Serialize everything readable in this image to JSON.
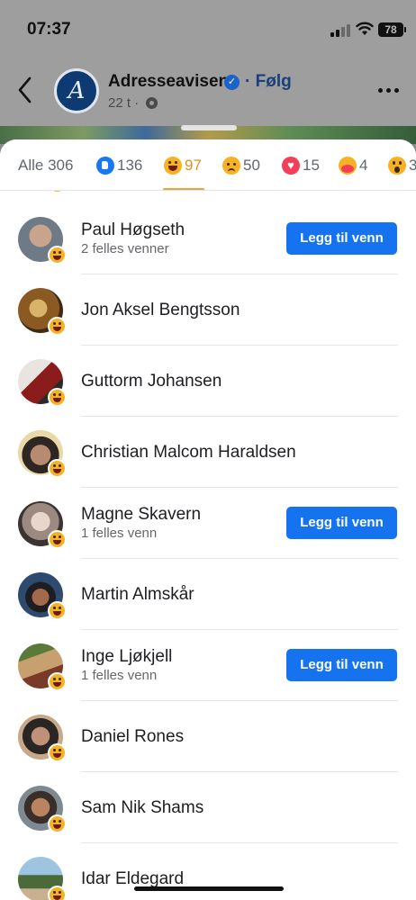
{
  "status_bar": {
    "time": "07:37",
    "battery": "78",
    "icons": [
      "signal-icon",
      "wifi-icon",
      "battery-icon"
    ]
  },
  "header": {
    "back_icon": "chevron-left-icon",
    "page_name": "Adresseavisen",
    "follow_label": "· Følg",
    "time_ago": "22 t ·",
    "logo_letter": "A",
    "more_icon": "more-icon"
  },
  "tabs": [
    {
      "label": "Alle 306",
      "icon": ""
    },
    {
      "label": "136",
      "icon": "like-icon"
    },
    {
      "label": "97",
      "icon": "haha-icon",
      "active": true
    },
    {
      "label": "50",
      "icon": "sad-icon"
    },
    {
      "label": "15",
      "icon": "love-icon"
    },
    {
      "label": "4",
      "icon": "care-icon"
    },
    {
      "label": "3",
      "icon": "wow-icon"
    }
  ],
  "people": [
    {
      "name": "Paul Høgseth",
      "mutual": "2 felles venner",
      "button": "Legg til venn"
    },
    {
      "name": "Jon Aksel Bengtsson"
    },
    {
      "name": "Guttorm Johansen"
    },
    {
      "name": "Christian Malcom Haraldsen"
    },
    {
      "name": "Magne Skavern",
      "mutual": "1 felles venn",
      "button": "Legg til venn"
    },
    {
      "name": "Martin Almskår"
    },
    {
      "name": "Inge Ljøkjell",
      "mutual": "1 felles venn",
      "button": "Legg til venn"
    },
    {
      "name": "Daniel Rones"
    },
    {
      "name": "Sam Nik Shams"
    },
    {
      "name": "Idar Eldegard"
    }
  ],
  "colors": {
    "accent_blue": "#1673f0",
    "haha_yellow": "#f7b125",
    "active_tab": "#e0901a"
  }
}
